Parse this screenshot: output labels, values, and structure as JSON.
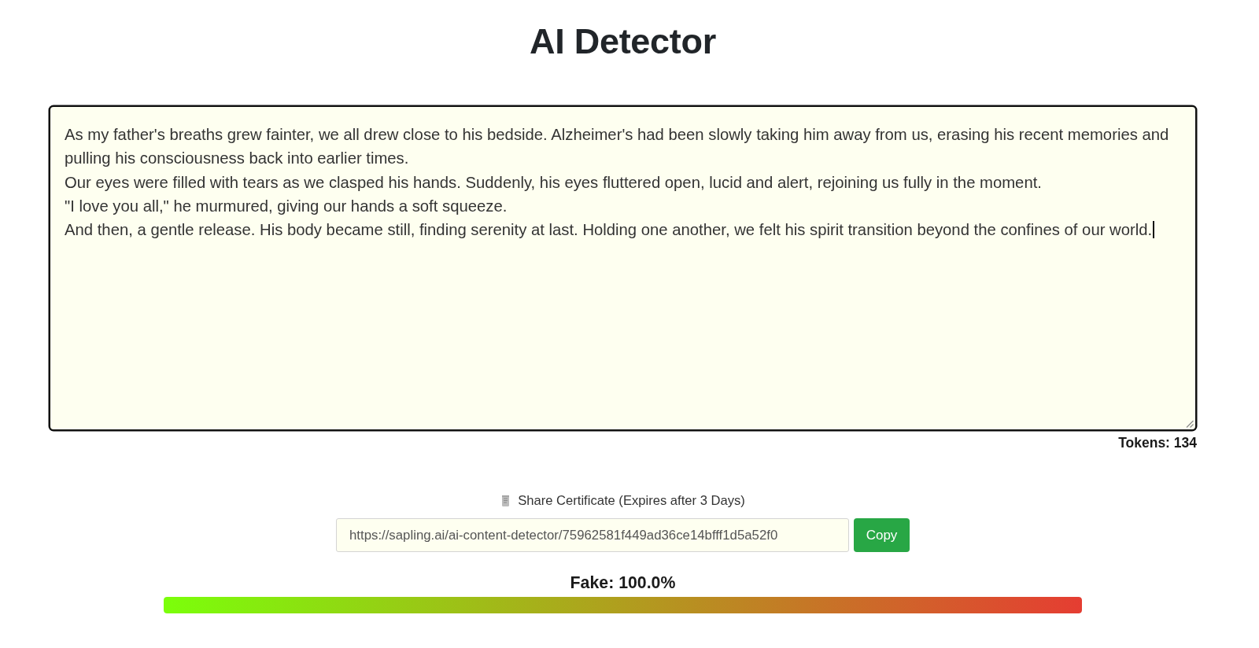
{
  "title": "AI Detector",
  "text_input": {
    "focused": true,
    "paragraphs": [
      "As my father's breaths grew fainter, we all drew close to his bedside. Alzheimer's had been slowly taking him away from us, erasing his recent memories and pulling his consciousness back into earlier times.",
      "Our eyes were filled with tears as we clasped his hands. Suddenly, his eyes fluttered open, lucid and alert, rejoining us fully in the moment.",
      "\"I love you all,\" he murmured, giving our hands a soft squeeze.",
      "And then, a gentle release. His body became still, finding serenity at last. Holding one another, we felt his spirit transition beyond the confines of our world."
    ]
  },
  "tokens": "Tokens: 134",
  "share": {
    "label": "Share Certificate (Expires after 3 Days)",
    "url": "https://sapling.ai/ai-content-detector/75962581f449ad36ce14bfff1d5a52f0",
    "button": "Copy"
  },
  "result": {
    "label": "Fake: 100.0%",
    "level": 1.0
  }
}
